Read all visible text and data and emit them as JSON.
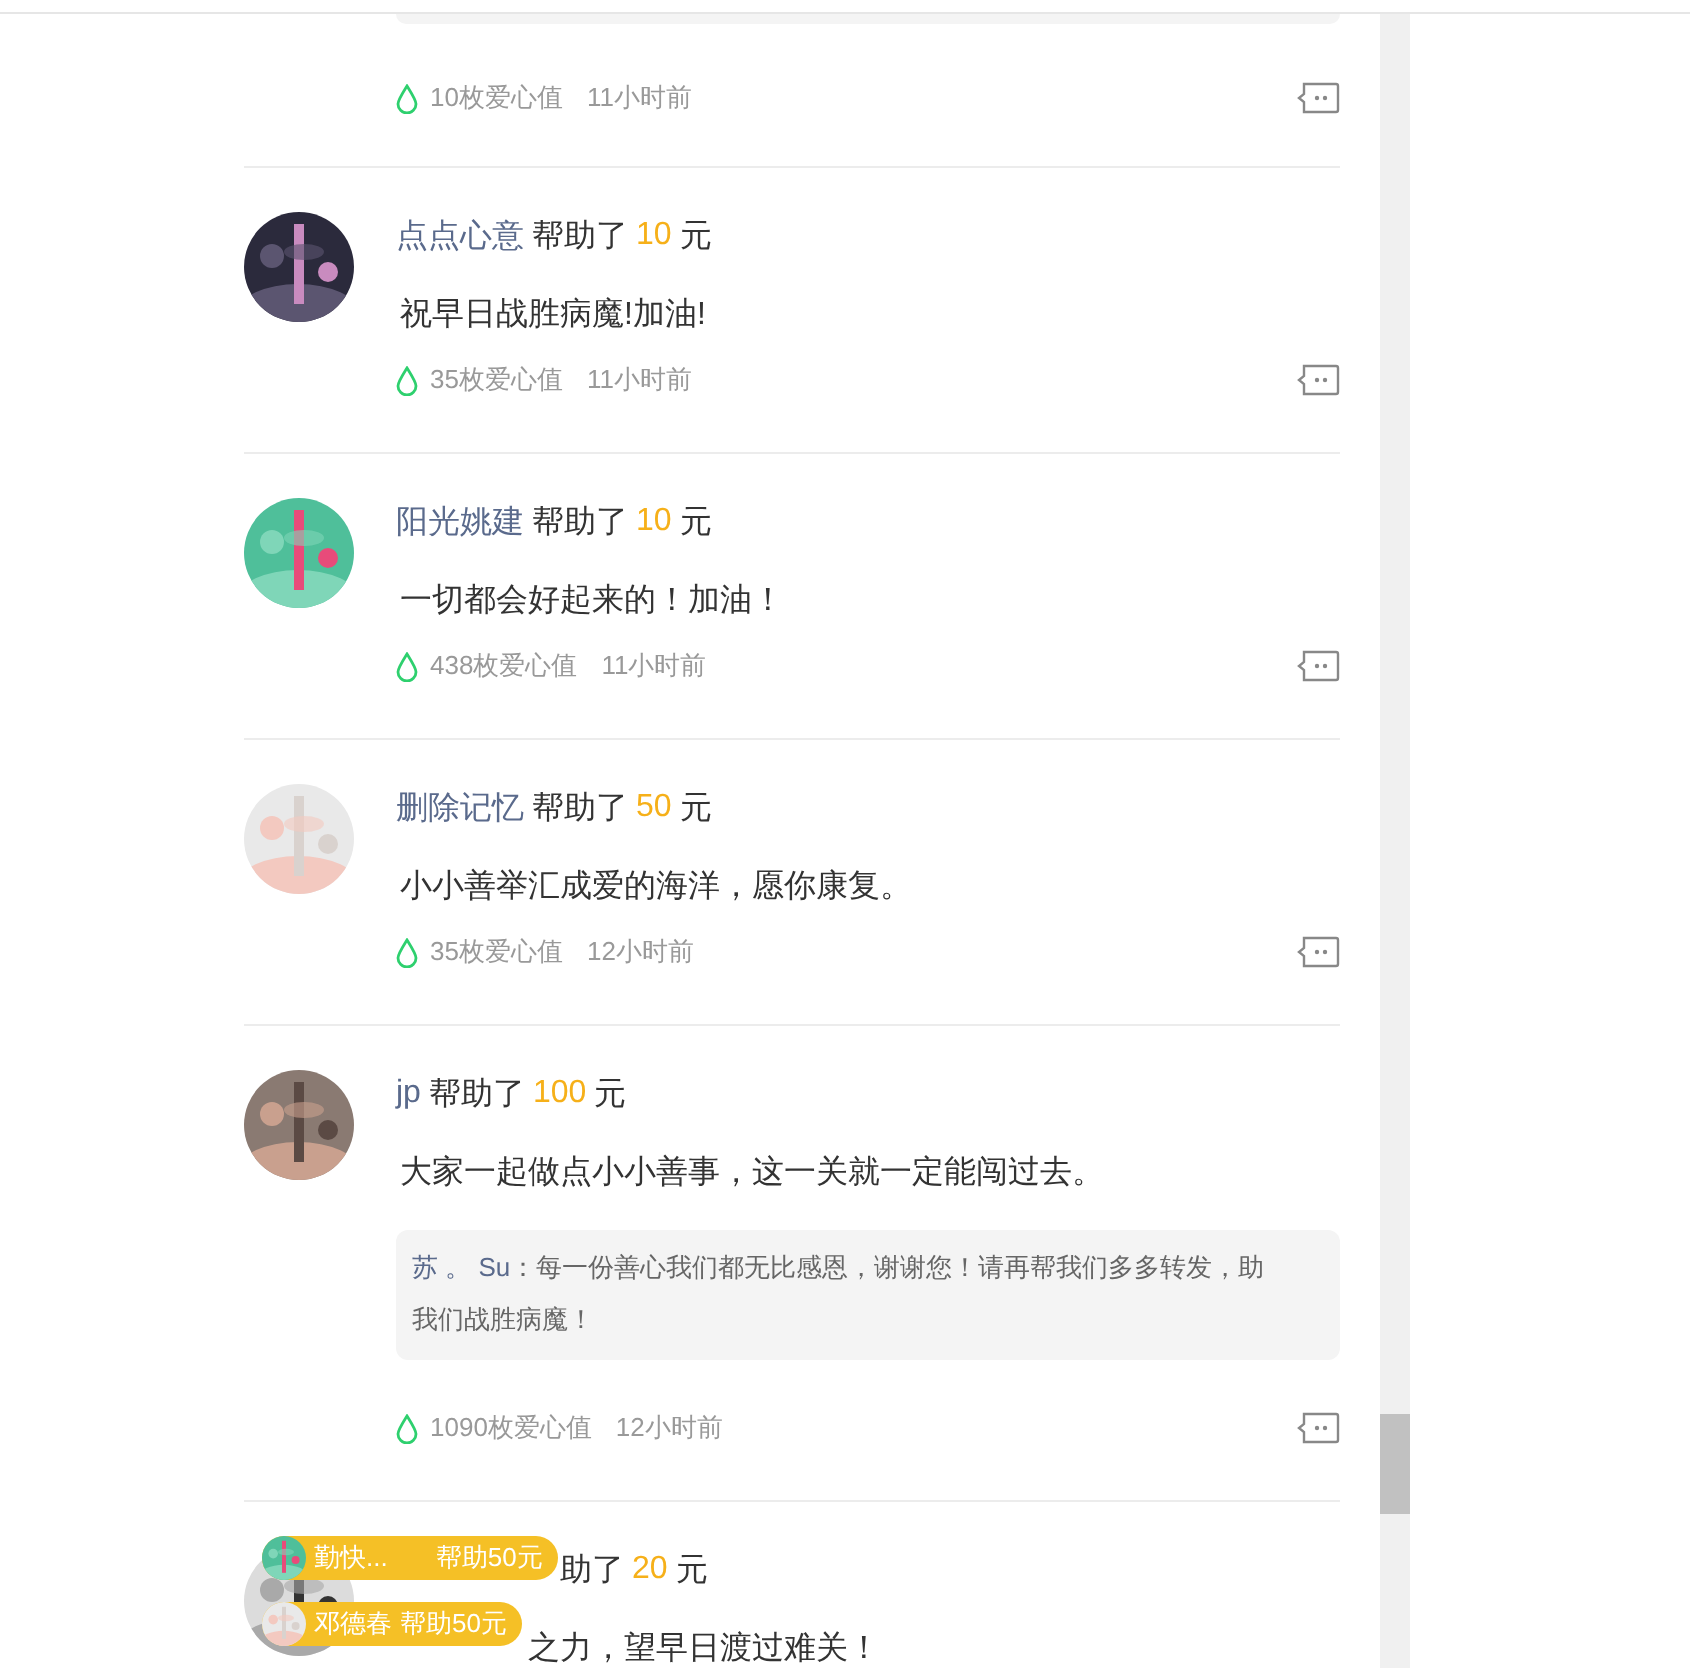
{
  "top_comment": {
    "hearts": "10枚爱心值",
    "time": "11小时前"
  },
  "comments": [
    {
      "name": "点点心意",
      "helped": "帮助了",
      "amount": "10",
      "unit": "元",
      "text": "祝早日战胜病魔!加油!",
      "hearts": "35枚爱心值",
      "time": "11小时前"
    },
    {
      "name": "阳光姚建",
      "helped": "帮助了",
      "amount": "10",
      "unit": "元",
      "text": "一切都会好起来的！加油！",
      "hearts": "438枚爱心值",
      "time": "11小时前"
    },
    {
      "name": "删除记忆",
      "helped": "帮助了",
      "amount": "50",
      "unit": "元",
      "text": "小小善举汇成爱的海洋，愿你康复。",
      "hearts": "35枚爱心值",
      "time": "12小时前"
    },
    {
      "name": "jp",
      "helped": "帮助了",
      "amount": "100",
      "unit": "元",
      "text": "大家一起做点小小善事，这一关就一定能闯过去。",
      "reply": {
        "name": "苏 。 Su",
        "text": "：每一份善心我们都无比感恩，谢谢您！请再帮我们多多转发，助我们战胜病魔！"
      },
      "hearts": "1090枚爱心值",
      "time": "12小时前"
    },
    {
      "helped": "助了",
      "amount": "20",
      "unit": "元",
      "text": "之力，望早日渡过难关！"
    }
  ],
  "toasts": [
    {
      "name": "勤快...",
      "text": "帮助50元"
    },
    {
      "name": "邓德春",
      "text": "帮助50元"
    }
  ]
}
